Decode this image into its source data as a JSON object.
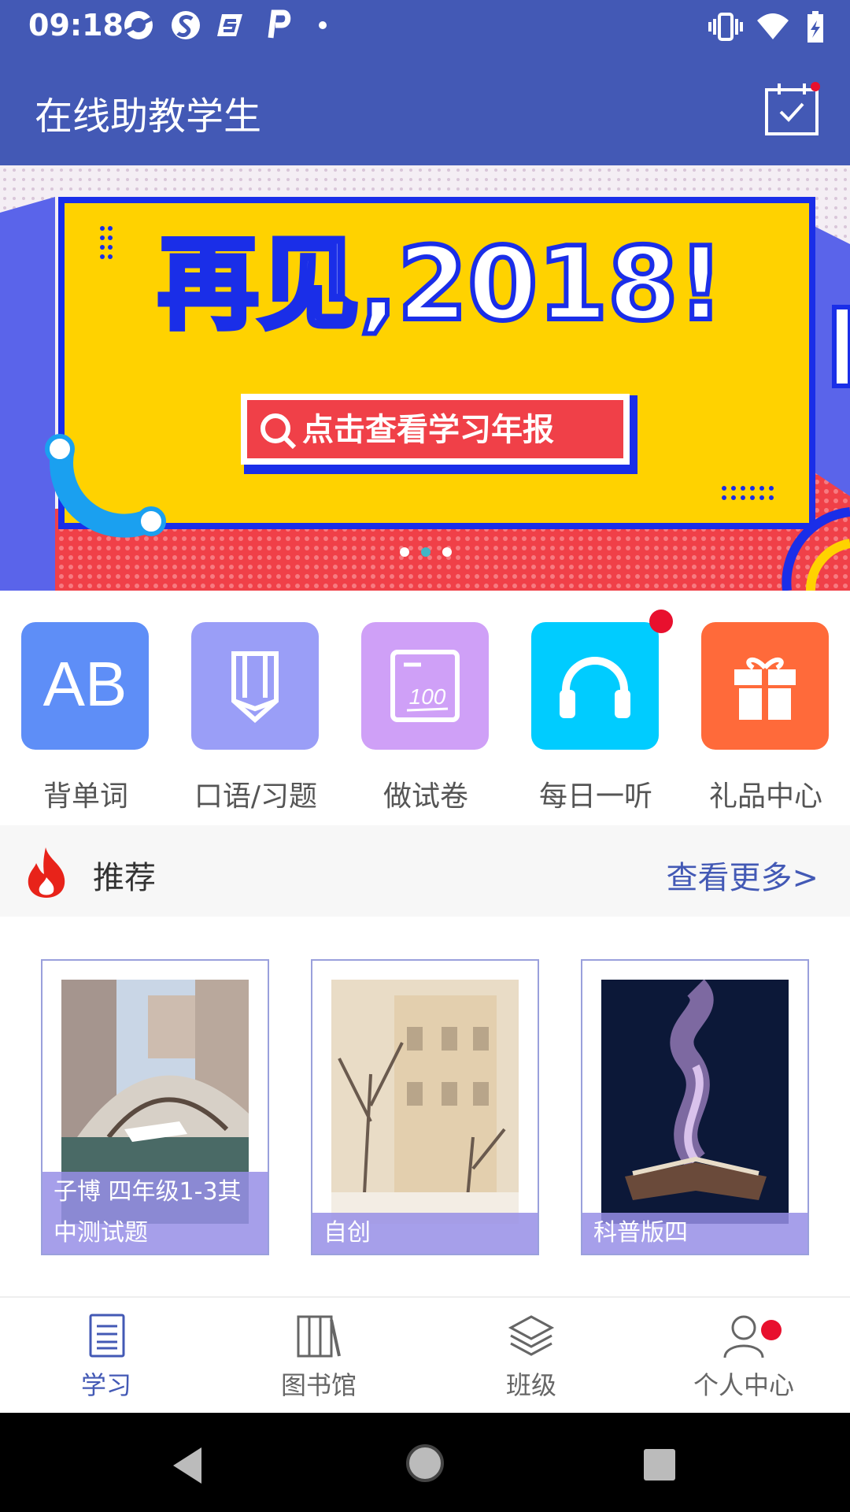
{
  "status_bar": {
    "time": "09:18",
    "notification_icons": [
      "browser-icon",
      "sogou-icon",
      "app-s-icon",
      "parking-icon",
      "dot-icon"
    ],
    "system_icons": [
      "vibrate-icon",
      "wifi-icon",
      "battery-icon"
    ]
  },
  "app_bar": {
    "title": "在线助教学生",
    "action_icon": "calendar-check-icon"
  },
  "banner": {
    "headline": "再见,2018!",
    "button_label": "点击查看学习年报",
    "page_count": 3,
    "active_page": 2
  },
  "features": [
    {
      "label": "背单词",
      "icon": "ab-icon",
      "color": "#5e8ef7"
    },
    {
      "label": "口语/习题",
      "icon": "pencil-icon",
      "color": "#9a9ef7"
    },
    {
      "label": "做试卷",
      "icon": "test-paper-icon",
      "color": "#cfa0f7"
    },
    {
      "label": "每日一听",
      "icon": "headphones-icon",
      "color": "#00ccff",
      "has_badge": true
    },
    {
      "label": "礼品中心",
      "icon": "gift-icon",
      "color": "#ff6a3a"
    }
  ],
  "recommend": {
    "label": "推荐",
    "more": "查看更多>"
  },
  "books": [
    {
      "title": "子博 四年级1-3其中测试题"
    },
    {
      "title": "自创"
    },
    {
      "title": "科普版四"
    }
  ],
  "bottom_nav": [
    {
      "label": "学习",
      "icon": "document-icon",
      "active": true
    },
    {
      "label": "图书馆",
      "icon": "books-icon",
      "active": false
    },
    {
      "label": "班级",
      "icon": "layers-icon",
      "active": false
    },
    {
      "label": "个人中心",
      "icon": "user-icon",
      "active": false,
      "has_badge": true
    }
  ],
  "colors": {
    "primary": "#4359b5",
    "badge": "#e8102e",
    "banner_yellow": "#ffd200",
    "banner_blue": "#1a2ee8",
    "banner_red": "#f04048"
  }
}
